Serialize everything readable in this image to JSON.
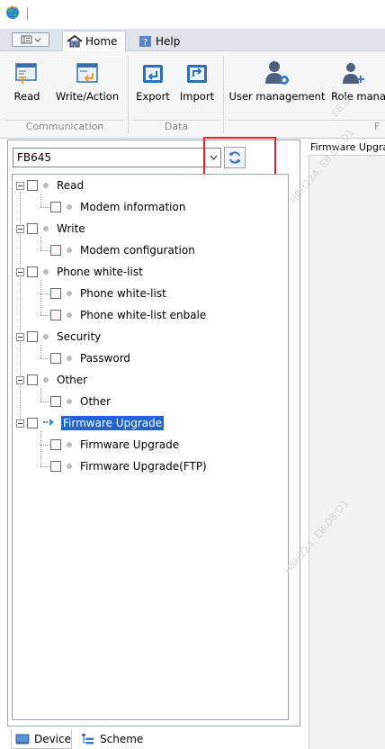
{
  "ribbon_tabs": {
    "home": "Home",
    "help": "Help"
  },
  "ribbon": {
    "buttons": {
      "read": "Read",
      "write_action": "Write/Action",
      "export": "Export",
      "import": "Import",
      "user_management": "User management",
      "role_management": "Role mana"
    },
    "groups": {
      "communication": "Communication",
      "data": "Data",
      "partial": "F"
    }
  },
  "device_select": {
    "value": "FB645"
  },
  "tree": {
    "read": "Read",
    "modem_information": "Modem information",
    "write": "Write",
    "modem_configuration": "Modem configuration",
    "phone_white_list": "Phone white-list",
    "phone_white_list_item": "Phone white-list",
    "phone_white_list_enable": "Phone white-list enbale",
    "security": "Security",
    "password": "Password",
    "other": "Other",
    "other_item": "Other",
    "firmware_upgrade": "Firmware Upgrade",
    "firmware_upgrade_item": "Firmware Upgrade",
    "firmware_upgrade_ftp": "Firmware Upgrade(FTP)"
  },
  "bottom_tabs": {
    "device": "Device",
    "scheme": "Scheme"
  },
  "document_tab": {
    "title": "Firmware Upgra"
  },
  "watermarks": [
    "H8H224. E8:D8:D1",
    "H8H224. E8:D8:D1",
    "E8:D"
  ],
  "icons": {
    "app": "app-globe-icon",
    "refresh": "refresh-icon",
    "tree_selected": "arrow-right-icon"
  },
  "colors": {
    "selection": "#1f66d1",
    "highlight_box": "#e52626",
    "refresh_icon": "#3a78c8"
  }
}
